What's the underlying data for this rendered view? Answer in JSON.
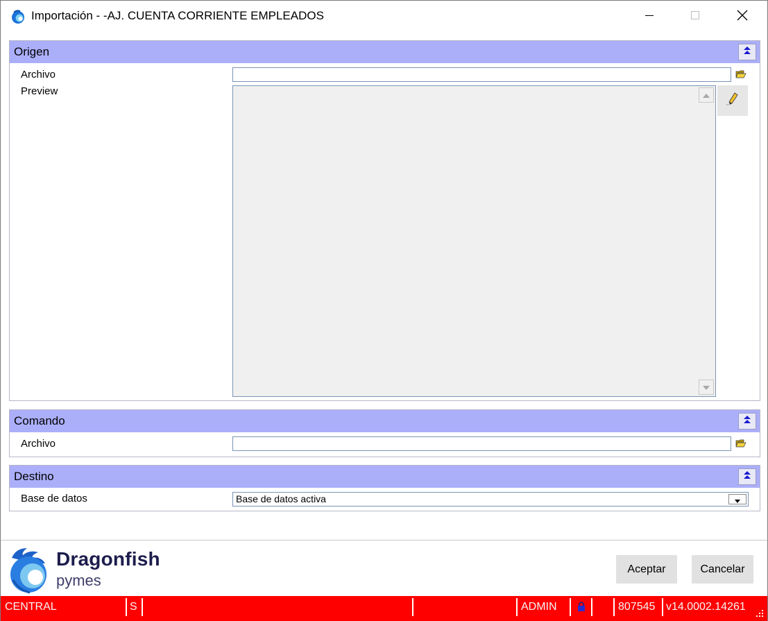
{
  "window": {
    "title": "Importación - -AJ. CUENTA CORRIENTE EMPLEADOS",
    "app_icon": "dragonfish-icon",
    "minimize_icon": "minimize-icon",
    "maximize_icon": "maximize-icon",
    "close_icon": "close-icon"
  },
  "origen": {
    "title": "Origen",
    "archivo_label": "Archivo",
    "archivo_value": "",
    "preview_label": "Preview",
    "preview_value": ""
  },
  "comando": {
    "title": "Comando",
    "archivo_label": "Archivo",
    "archivo_value": ""
  },
  "destino": {
    "title": "Destino",
    "base_label": "Base de datos",
    "base_value": "Base de datos activa"
  },
  "brand": {
    "name": "Dragonfish",
    "sub": "pymes"
  },
  "buttons": {
    "ok": "Aceptar",
    "cancel": "Cancelar"
  },
  "statusbar": {
    "central": "CENTRAL",
    "s": "S",
    "user": "ADMIN",
    "code": "807545",
    "version": "v14.0002.14261",
    "lock_icon": "lock-icon"
  },
  "colors": {
    "section_header": "#abaef9",
    "statusbar": "#ff0000"
  }
}
